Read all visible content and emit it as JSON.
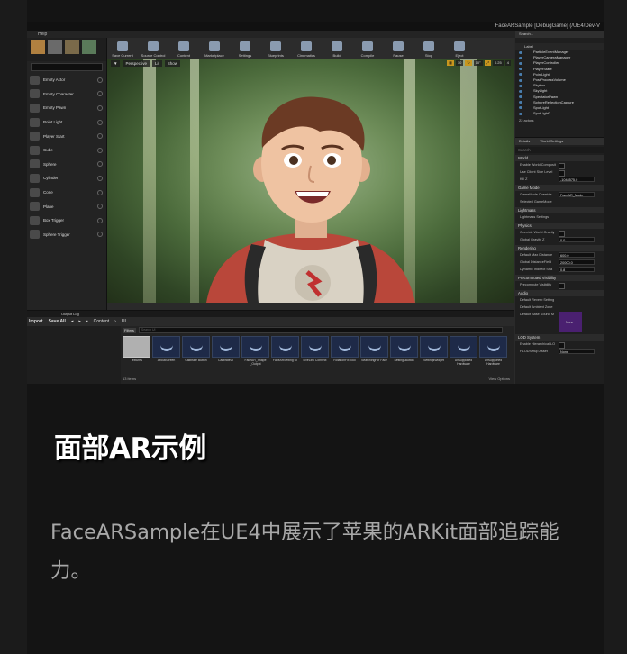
{
  "window": {
    "title": "FaceARSample [DebugGame] (/UE4/Dev-V"
  },
  "menu": [
    "Help"
  ],
  "toolbar": {
    "buttons": [
      "Save Current",
      "Source Control",
      "Content",
      "Marketplace",
      "Settings",
      "Blueprints",
      "Cinematics",
      "Build",
      "Compile",
      "Pause",
      "Stop",
      "Eject"
    ]
  },
  "modes_panel": {
    "items": [
      "Empty Actor",
      "Empty Character",
      "Empty Pawn",
      "Point Light",
      "Player Start",
      "Cube",
      "Sphere",
      "Cylinder",
      "Cone",
      "Plane",
      "Box Trigger",
      "Sphere Trigger"
    ]
  },
  "viewport": {
    "view_mode": "Perspective",
    "lighting": "Lit",
    "show": "Show",
    "grid_snap": "10",
    "rot_snap": "10°",
    "scale_snap": "0.25",
    "cam_speed": "4"
  },
  "outliner": {
    "search_placeholder": "Search...",
    "column": "Label",
    "items": [
      "ParticleEventManager",
      "PlayerCameraManager",
      "PlayerController",
      "PlayerState",
      "PointLight",
      "PostProcessVolume",
      "Skybox",
      "SkyLight",
      "SpectatorPawn",
      "SphereReflectionCapture",
      "SpotLight",
      "SpotLight2"
    ],
    "count": "22 actors"
  },
  "details": {
    "tabs": [
      "Details",
      "World Settings"
    ],
    "search_placeholder": "Search",
    "sections": {
      "world": "World",
      "enable_world_composition": "Enable World Composit",
      "use_client_side_level": "Use Client Side Level",
      "kill_z_label": "Kill Z",
      "kill_z": "-1048575.0",
      "game_mode": "Game Mode",
      "gamemode_override_label": "GameMode Override",
      "gamemode_override": "FaceAR_Mode",
      "selected_gamemode": "Selected GameMode",
      "lightmass": "Lightmass",
      "lightmass_settings": "Lightmass Settings",
      "physics": "Physics",
      "override_world_gravity": "Override World Gravity",
      "global_gravity_z_label": "Global Gravity Z",
      "global_gravity_z": "0.0",
      "rendering": "Rendering",
      "default_max_distance_label": "Default Max Distance",
      "default_max_distance": "600.0",
      "global_distance_field_label": "Global DistanceField",
      "global_distance_field": "20000.0",
      "dynamic_indirect_label": "Dynamic Indirect Sha",
      "dynamic_indirect": "0.8",
      "precomputed_visibility": "Precomputed Visibility",
      "precompute_visibility": "Precompute Visibility",
      "audio": "Audio",
      "default_reverb": "Default Reverb Setting",
      "default_ambient": "Default Ambient Zone",
      "default_base_sound": "Default Base Sound M",
      "swatch_label": "None",
      "lod_system": "LOD System",
      "enable_hierarchical": "Enable Hierarchical LO",
      "hlod_setup_label": "HLODSetup Asset",
      "hlod_setup": "None"
    }
  },
  "content_browser": {
    "tab": "Output Log",
    "import_label": "Import",
    "save_all_label": "Save All",
    "path": [
      "Content",
      "UI"
    ],
    "filters_label": "Filters",
    "search_placeholder": "Search UI",
    "assets": [
      "Textures",
      "AboutScreen",
      "Calibrate Button",
      "CalibrateUI",
      "FaceAR_Shape _Output",
      "FaceARSetting UI",
      "LiveLink Connect",
      "RotationFix Tool",
      "SearchingFor Face",
      "SettingsButton",
      "SettingsWidget",
      "Unsupported Hardware",
      "Unsupported Hardware"
    ],
    "count": "13 items",
    "view_options": "View Options"
  },
  "caption": {
    "title": "面部AR示例",
    "body": "FaceARSample在UE4中展示了苹果的ARKit面部追踪能力。"
  },
  "colors": {
    "page_bg": "#1b1b1b",
    "card_bg": "#141414",
    "title": "#ffffff",
    "body": "#a8a8a8",
    "accent": "#c8961e"
  }
}
